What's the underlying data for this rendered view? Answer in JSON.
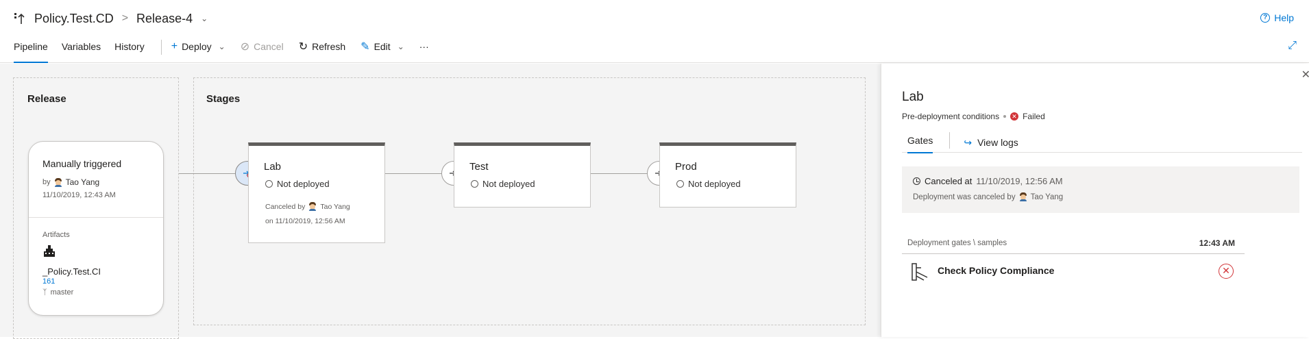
{
  "header": {
    "pipeline_name": "Policy.Test.CD",
    "separator": ">",
    "release_name": "Release-4",
    "help_label": "Help"
  },
  "toolbar": {
    "tabs": [
      "Pipeline",
      "Variables",
      "History"
    ],
    "deploy_label": "Deploy",
    "cancel_label": "Cancel",
    "refresh_label": "Refresh",
    "edit_label": "Edit",
    "more_label": "···"
  },
  "release": {
    "section_title": "Release",
    "trigger_title": "Manually triggered",
    "by_label": "by",
    "user": "Tao Yang",
    "date": "11/10/2019, 12:43 AM",
    "artifacts_label": "Artifacts",
    "artifact_name": "_Policy.Test.CI",
    "artifact_build": "161",
    "artifact_branch": "master"
  },
  "stages": {
    "section_title": "Stages",
    "items": [
      {
        "name": "Lab",
        "status": "Not deployed",
        "canceled_by_label": "Canceled by",
        "canceled_by": "Tao Yang",
        "canceled_on": "on 11/10/2019, 12:56 AM"
      },
      {
        "name": "Test",
        "status": "Not deployed"
      },
      {
        "name": "Prod",
        "status": "Not deployed"
      }
    ]
  },
  "panel": {
    "title": "Lab",
    "subtitle": "Pre-deployment conditions",
    "status": "Failed",
    "tabs": {
      "gates": "Gates",
      "view_logs": "View logs"
    },
    "canceled_label": "Canceled at",
    "canceled_at": "11/10/2019, 12:56 AM",
    "canceled_by_text": "Deployment was canceled by",
    "canceled_by": "Tao Yang",
    "gates_header": "Deployment gates \\ samples",
    "gates_time": "12:43 AM",
    "gate_name": "Check Policy Compliance"
  },
  "colors": {
    "accent": "#0078d4",
    "error": "#d13438"
  }
}
